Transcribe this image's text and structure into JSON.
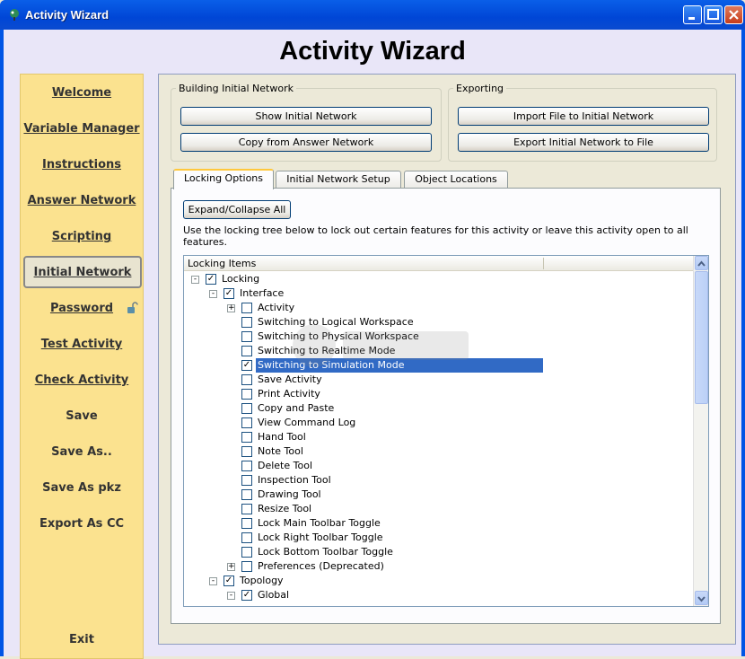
{
  "window": {
    "title": "Activity Wizard"
  },
  "header": {
    "title": "Activity Wizard"
  },
  "sidebar": {
    "items": [
      {
        "label": "Welcome"
      },
      {
        "label": "Variable Manager"
      },
      {
        "label": "Instructions"
      },
      {
        "label": "Answer Network"
      },
      {
        "label": "Scripting"
      },
      {
        "label": "Initial Network",
        "active": true
      },
      {
        "label": "Password"
      },
      {
        "label": "Test Activity"
      },
      {
        "label": "Check Activity"
      },
      {
        "label": "Save"
      },
      {
        "label": "Save As.."
      },
      {
        "label": "Save As pkz"
      },
      {
        "label": "Export As CC"
      },
      {
        "label": "Exit"
      }
    ]
  },
  "building": {
    "legend": "Building Initial Network",
    "show_btn": "Show Initial Network",
    "copy_btn": "Copy from Answer Network"
  },
  "exporting": {
    "legend": "Exporting",
    "import_btn": "Import File to Initial Network",
    "export_btn": "Export Initial Network to File"
  },
  "tabs": [
    "Locking Options",
    "Initial Network Setup",
    "Object Locations"
  ],
  "locking": {
    "expand_btn": "Expand/Collapse All",
    "description": "Use the locking tree below to lock out certain features for this activity or leave this activity open to all features.",
    "column_header": "Locking Items",
    "tree": [
      {
        "label": "Locking",
        "level": 0,
        "checked": true,
        "expander": "-"
      },
      {
        "label": "Interface",
        "level": 1,
        "checked": true,
        "expander": "-"
      },
      {
        "label": "Activity",
        "level": 2,
        "checked": false,
        "expander": "+"
      },
      {
        "label": "Switching to Logical Workspace",
        "level": 2,
        "checked": false
      },
      {
        "label": "Switching to Physical Workspace",
        "level": 2,
        "checked": false
      },
      {
        "label": "Switching to Realtime Mode",
        "level": 2,
        "checked": false
      },
      {
        "label": "Switching to Simulation Mode",
        "level": 2,
        "checked": true,
        "selected": true
      },
      {
        "label": "Save Activity",
        "level": 2,
        "checked": false
      },
      {
        "label": "Print Activity",
        "level": 2,
        "checked": false
      },
      {
        "label": "Copy and Paste",
        "level": 2,
        "checked": false
      },
      {
        "label": "View Command Log",
        "level": 2,
        "checked": false
      },
      {
        "label": "Hand Tool",
        "level": 2,
        "checked": false
      },
      {
        "label": "Note Tool",
        "level": 2,
        "checked": false
      },
      {
        "label": "Delete Tool",
        "level": 2,
        "checked": false
      },
      {
        "label": "Inspection Tool",
        "level": 2,
        "checked": false
      },
      {
        "label": "Drawing Tool",
        "level": 2,
        "checked": false
      },
      {
        "label": "Resize Tool",
        "level": 2,
        "checked": false
      },
      {
        "label": "Lock Main Toolbar Toggle",
        "level": 2,
        "checked": false
      },
      {
        "label": "Lock Right Toolbar Toggle",
        "level": 2,
        "checked": false
      },
      {
        "label": "Lock Bottom Toolbar Toggle",
        "level": 2,
        "checked": false
      },
      {
        "label": "Preferences (Deprecated)",
        "level": 2,
        "checked": false,
        "expander": "+"
      },
      {
        "label": "Topology",
        "level": 1,
        "checked": true,
        "expander": "-"
      },
      {
        "label": "Global",
        "level": 2,
        "checked": true,
        "expander": "-"
      }
    ]
  },
  "colors": {
    "titlebar": "#0A5FE8",
    "sidebar_bg": "#FBE28F",
    "client_bg": "#E9E6F8",
    "selection": "#316AC5",
    "tab_highlight": "#FFC83C"
  }
}
